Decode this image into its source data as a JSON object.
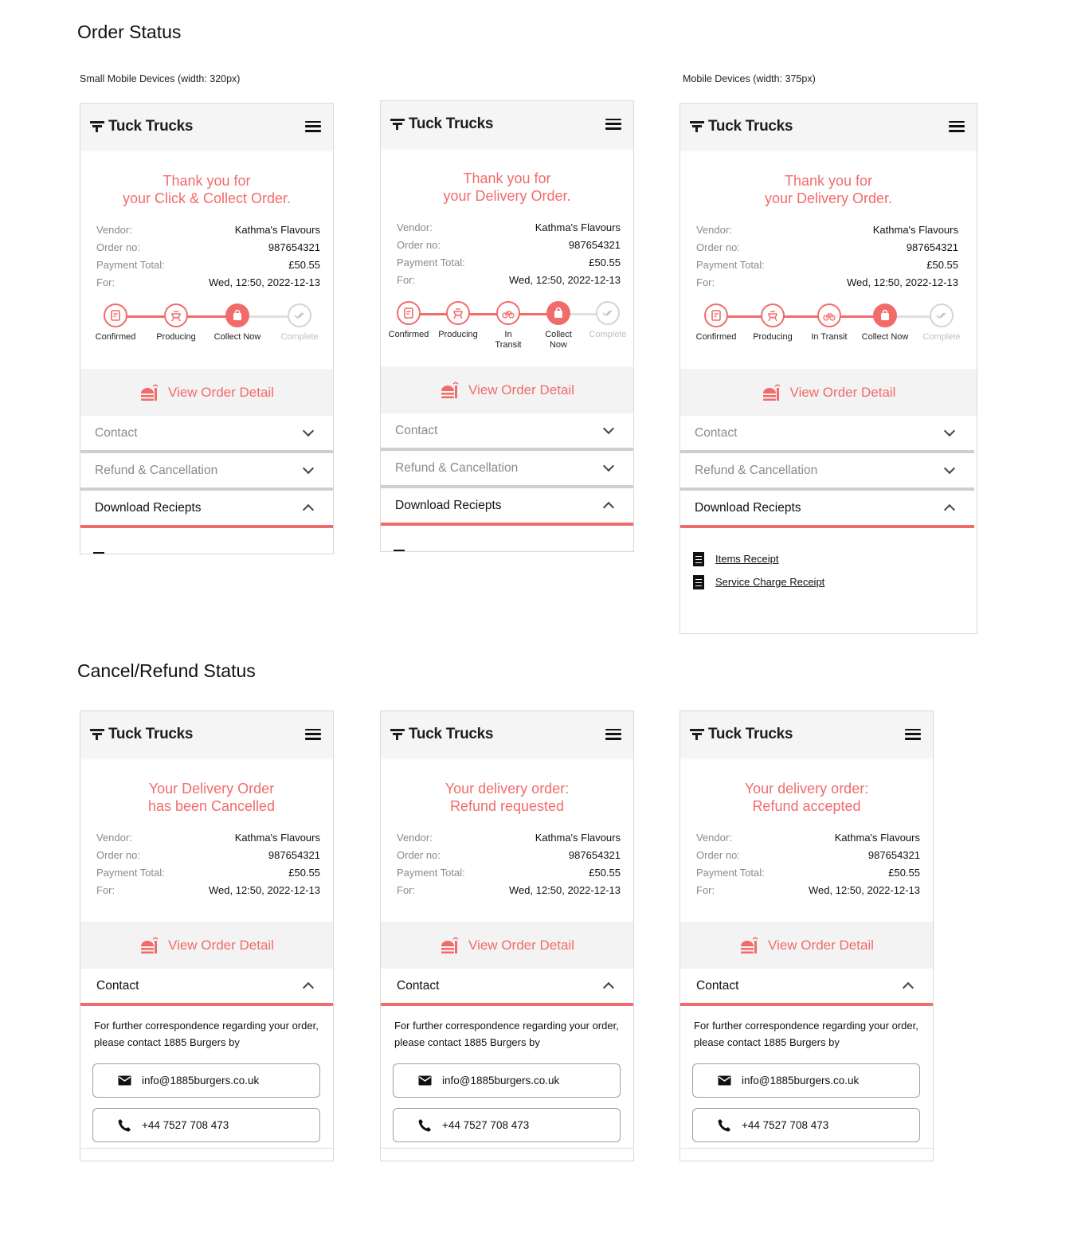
{
  "sections": {
    "order_status": "Order Status",
    "cancel_refund": "Cancel/Refund Status"
  },
  "device_labels": {
    "small": "Small Mobile Devices (width: 320px)",
    "mobile": "Mobile Devices (width: 375px)"
  },
  "brand": "Tuck Trucks",
  "labels": {
    "vendor": "Vendor:",
    "order_no": "Order no:",
    "payment_total": "Payment Total:",
    "for": "For:"
  },
  "order": {
    "vendor": "Kathma's Flavours",
    "order_no": "987654321",
    "payment_total": "£50.55",
    "for": "Wed, 12:50, 2022-12-13"
  },
  "view_order_detail": "View Order Detail",
  "accordion": {
    "contact": "Contact",
    "refund": "Refund & Cancellation",
    "download": "Download Reciepts"
  },
  "receipts": {
    "items": "Items Receipt",
    "service": "Service Charge Receipt"
  },
  "steps": {
    "confirmed": "Confirmed",
    "producing": "Producing",
    "collect_now": "Collect Now",
    "complete": "Complete",
    "in_transit": "In Transit",
    "in": "In",
    "transit": "Transit",
    "collect": "Collect",
    "now": "Now"
  },
  "screens": {
    "s1": {
      "title1": "Thank you for",
      "title2": "your Click & Collect Order."
    },
    "s2": {
      "title1": "Thank you for",
      "title2": "your Delivery Order."
    },
    "s3": {
      "title1": "Thank you for",
      "title2": "your Delivery Order."
    },
    "c1": {
      "title1": "Your Delivery Order",
      "title2": "has been Cancelled"
    },
    "c2": {
      "title1": "Your delivery order:",
      "title2": "Refund requested"
    },
    "c3": {
      "title1": "Your delivery order:",
      "title2": "Refund accepted"
    }
  },
  "contact": {
    "text": "For further correspondence regarding your order, please contact 1885 Burgers by",
    "email": "info@1885burgers.co.uk",
    "phone": "+44 7527 708 473"
  },
  "colors": {
    "accent": "#f26b6b",
    "muted": "#8a8a8a"
  }
}
